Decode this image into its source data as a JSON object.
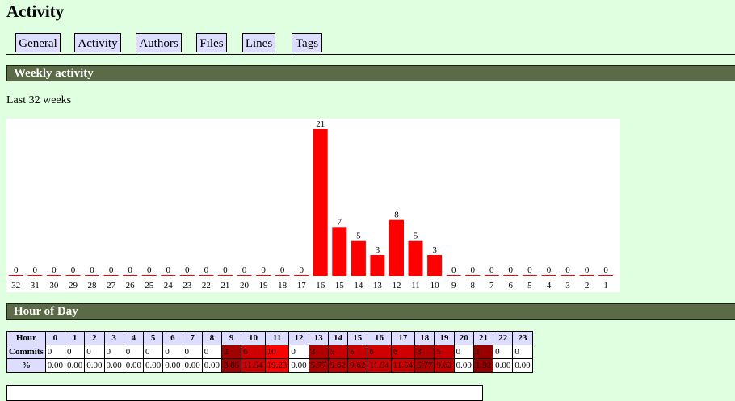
{
  "page": {
    "title": "Activity"
  },
  "tabs": [
    {
      "label": "General"
    },
    {
      "label": "Activity"
    },
    {
      "label": "Authors"
    },
    {
      "label": "Files"
    },
    {
      "label": "Lines"
    },
    {
      "label": "Tags"
    }
  ],
  "weekly": {
    "header": "Weekly activity",
    "subtitle": "Last 32 weeks"
  },
  "hour_of_day": {
    "header": "Hour of Day",
    "row_labels": {
      "hour": "Hour",
      "commits": "Commits",
      "percent": "%"
    },
    "hours": [
      "0",
      "1",
      "2",
      "3",
      "4",
      "5",
      "6",
      "7",
      "8",
      "9",
      "10",
      "11",
      "12",
      "13",
      "14",
      "15",
      "16",
      "17",
      "18",
      "19",
      "20",
      "21",
      "22",
      "23"
    ],
    "commits": [
      "0",
      "0",
      "0",
      "0",
      "0",
      "0",
      "0",
      "0",
      "0",
      "2",
      "6",
      "10",
      "0",
      "3",
      "5",
      "5",
      "6",
      "6",
      "3",
      "5",
      "0",
      "1",
      "0",
      "0"
    ],
    "percents": [
      "0.00",
      "0.00",
      "0.00",
      "0.00",
      "0.00",
      "0.00",
      "0.00",
      "0.00",
      "0.00",
      "3.85",
      "11.54",
      "19.23",
      "0.00",
      "5.77",
      "9.62",
      "9.62",
      "11.54",
      "11.54",
      "5.77",
      "9.62",
      "0.00",
      "1.92",
      "0.00",
      "0.00"
    ],
    "colors": {
      "zero": "#ffffff",
      "scale_low": "#8c0000",
      "scale_high": "#ff0000"
    }
  },
  "chart_data": {
    "type": "bar",
    "categories": [
      "32",
      "31",
      "30",
      "29",
      "28",
      "27",
      "26",
      "25",
      "24",
      "23",
      "22",
      "21",
      "20",
      "19",
      "18",
      "17",
      "16",
      "15",
      "14",
      "13",
      "12",
      "11",
      "10",
      "9",
      "8",
      "7",
      "6",
      "5",
      "4",
      "3",
      "2",
      "1"
    ],
    "values": [
      0,
      0,
      0,
      0,
      0,
      0,
      0,
      0,
      0,
      0,
      0,
      0,
      0,
      0,
      0,
      0,
      21,
      7,
      5,
      3,
      8,
      5,
      3,
      0,
      0,
      0,
      0,
      0,
      0,
      0,
      0,
      0
    ],
    "title": "",
    "xlabel": "",
    "ylabel": "",
    "ylim": [
      0,
      21
    ],
    "grid": false,
    "bar_color": "#ff0000",
    "data_labels": true
  }
}
